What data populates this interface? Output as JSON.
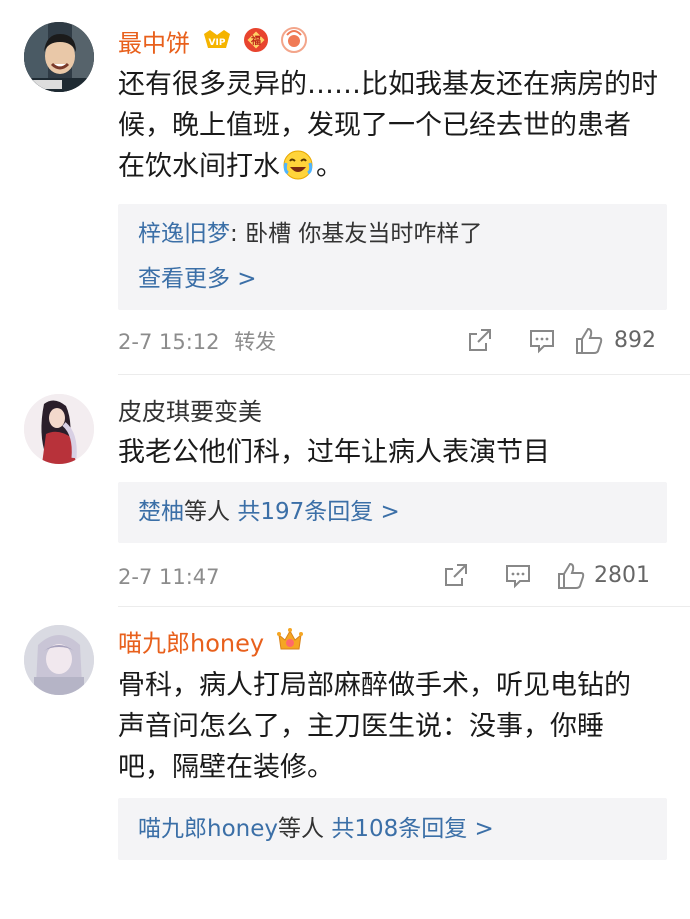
{
  "comments": [
    {
      "user": "最中饼",
      "badges": [
        "vip-icon",
        "fu-badge-icon",
        "fan-badge-icon"
      ],
      "text_lines": [
        "还有很多灵异的……比如我基友还在病房的时",
        "候，晚上值班，发现了一个已经去世的患者",
        "在饮水间打水"
      ],
      "text_end": "。",
      "reply": {
        "author": "梓逸旧梦",
        "sep": ": ",
        "content": "卧槽 你基友当时咋样了",
        "more": "查看更多 >"
      },
      "time": "2-7 15:12",
      "repost_label": "转发",
      "likes": "892"
    },
    {
      "user": "皮皮琪要变美",
      "text_lines": [
        "我老公他们科，过年让病人表演节目"
      ],
      "reply": {
        "author": "楚柚",
        "mid": "等人 ",
        "total": "共197条回复 >"
      },
      "time": "2-7 11:47",
      "likes": "2801"
    },
    {
      "user": "喵九郎honey",
      "badges": [
        "crown-badge-icon"
      ],
      "text_lines": [
        "骨科，病人打局部麻醉做手术，听见电钻的",
        "声音问怎么了，主刀医生说：没事，你睡",
        "吧，隔壁在装修。"
      ],
      "reply": {
        "author": "喵九郎honey",
        "mid": "等人 ",
        "total": "共108条回复 >"
      }
    }
  ],
  "colors": {
    "username_vip": "#e8601c",
    "username": "#333333",
    "link": "#3b6fa7",
    "meta": "#8c8c8c",
    "reply_bg": "#f4f4f6"
  }
}
